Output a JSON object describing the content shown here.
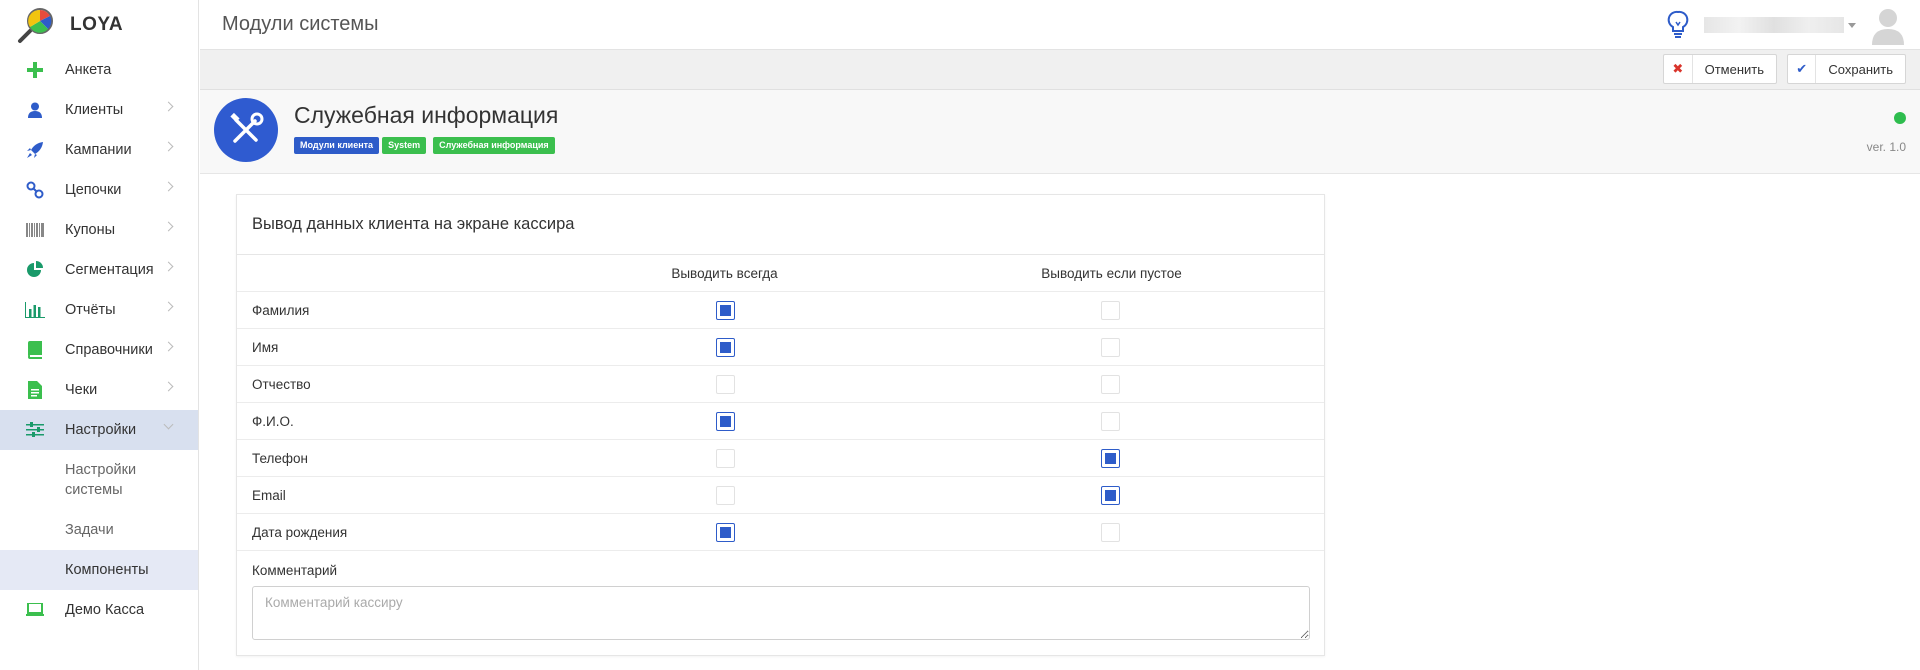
{
  "app": {
    "name": "LOYA"
  },
  "header": {
    "title": "Модули системы"
  },
  "sidebar": {
    "items": [
      {
        "label": "Анкета",
        "icon": "plus-icon",
        "has_children": false
      },
      {
        "label": "Клиенты",
        "icon": "user-icon",
        "has_children": true
      },
      {
        "label": "Кампании",
        "icon": "rocket-icon",
        "has_children": true
      },
      {
        "label": "Цепочки",
        "icon": "chain-icon",
        "has_children": true
      },
      {
        "label": "Купоны",
        "icon": "barcode-icon",
        "has_children": true
      },
      {
        "label": "Сегментация",
        "icon": "pie-chart-icon",
        "has_children": true
      },
      {
        "label": "Отчёты",
        "icon": "bar-chart-icon",
        "has_children": true
      },
      {
        "label": "Справочники",
        "icon": "book-icon",
        "has_children": true
      },
      {
        "label": "Чеки",
        "icon": "receipt-icon",
        "has_children": true
      },
      {
        "label": "Настройки",
        "icon": "sliders-icon",
        "has_children": true,
        "expanded": true
      }
    ],
    "subitems": [
      {
        "label": "Настройки системы"
      },
      {
        "label": "Задачи"
      },
      {
        "label": "Компоненты",
        "active": true
      }
    ],
    "last_item": {
      "label": "Демо Касса",
      "icon": "laptop-icon"
    }
  },
  "toolbar": {
    "cancel_label": "Отменить",
    "save_label": "Сохранить"
  },
  "module": {
    "title": "Служебная информация",
    "tags": [
      "Модули клиента",
      "System",
      "Служебная информация"
    ],
    "version": "ver. 1.0",
    "status_color": "#2ebd4e"
  },
  "panel": {
    "title": "Вывод данных клиента на экране кассира",
    "col_always": "Выводить всегда",
    "col_if_empty": "Выводить если пустое",
    "rows": [
      {
        "name": "Фамилия",
        "always": true,
        "if_empty": false
      },
      {
        "name": "Имя",
        "always": true,
        "if_empty": false
      },
      {
        "name": "Отчество",
        "always": false,
        "if_empty": false
      },
      {
        "name": "Ф.И.О.",
        "always": true,
        "if_empty": false
      },
      {
        "name": "Телефон",
        "always": false,
        "if_empty": true
      },
      {
        "name": "Email",
        "always": false,
        "if_empty": true
      },
      {
        "name": "Дата рождения",
        "always": true,
        "if_empty": false
      }
    ],
    "comment_label": "Комментарий",
    "comment_placeholder": "Комментарий кассиру",
    "comment_value": ""
  },
  "colors": {
    "accent": "#2e5cc9",
    "green": "#3bbf4e",
    "active_nav": "#d8e0ef"
  }
}
